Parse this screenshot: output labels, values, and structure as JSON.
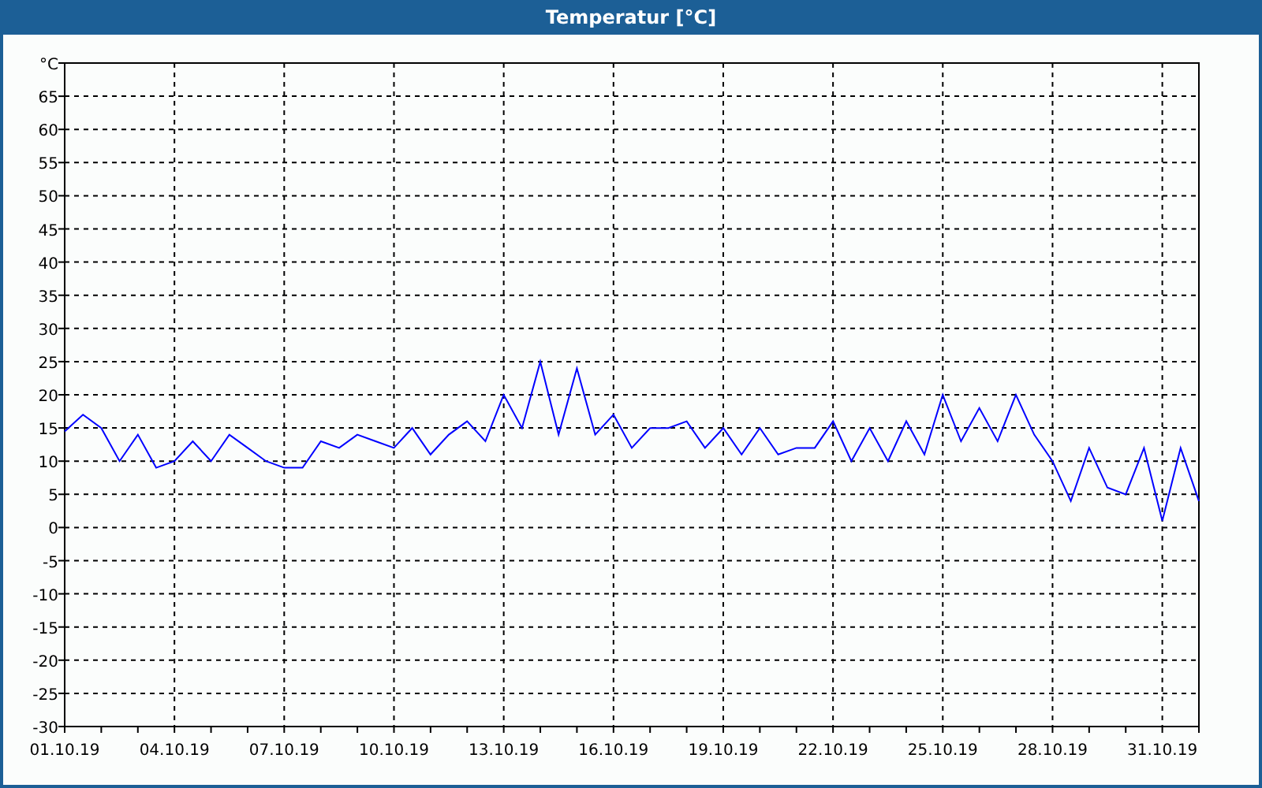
{
  "window": {
    "title": "Temperatur [°C]"
  },
  "chart": {
    "chart_data": {
      "type": "line",
      "grid": true,
      "ylim": [
        -30,
        70
      ],
      "yticks": [
        -30,
        -25,
        -20,
        -15,
        -10,
        -5,
        0,
        5,
        10,
        15,
        20,
        25,
        30,
        35,
        40,
        45,
        50,
        55,
        60,
        65,
        {
          "value": 70,
          "label": "°C"
        }
      ],
      "categories": [
        "01.10.19",
        null,
        null,
        null,
        null,
        null,
        "04.10.19",
        null,
        null,
        null,
        null,
        null,
        "07.10.19",
        null,
        null,
        null,
        null,
        null,
        "10.10.19",
        null,
        null,
        null,
        null,
        null,
        "13.10.19",
        null,
        null,
        null,
        null,
        null,
        "16.10.19",
        null,
        null,
        null,
        null,
        null,
        "19.10.19",
        null,
        null,
        null,
        null,
        null,
        "22.10.19",
        null,
        null,
        null,
        null,
        null,
        "25.10.19",
        null,
        null,
        null,
        null,
        null,
        "28.10.19",
        null,
        null,
        null,
        null,
        null,
        "31.10.19",
        null,
        null
      ],
      "series": [
        {
          "color": "#0000ff",
          "values": [
            14.5,
            17,
            15,
            10,
            14,
            9,
            10,
            13,
            10,
            14,
            12,
            10,
            9,
            9,
            13,
            12,
            14,
            13,
            12,
            15,
            11,
            14,
            16,
            13,
            20,
            15,
            25,
            14,
            24,
            14,
            17,
            12,
            15,
            15,
            16,
            12,
            15,
            11,
            15,
            11,
            12,
            12,
            16,
            10,
            15,
            10,
            16,
            11,
            20,
            13,
            18,
            13,
            20,
            14,
            10,
            4,
            12,
            6,
            5,
            12,
            1,
            12,
            4
          ]
        }
      ]
    }
  }
}
